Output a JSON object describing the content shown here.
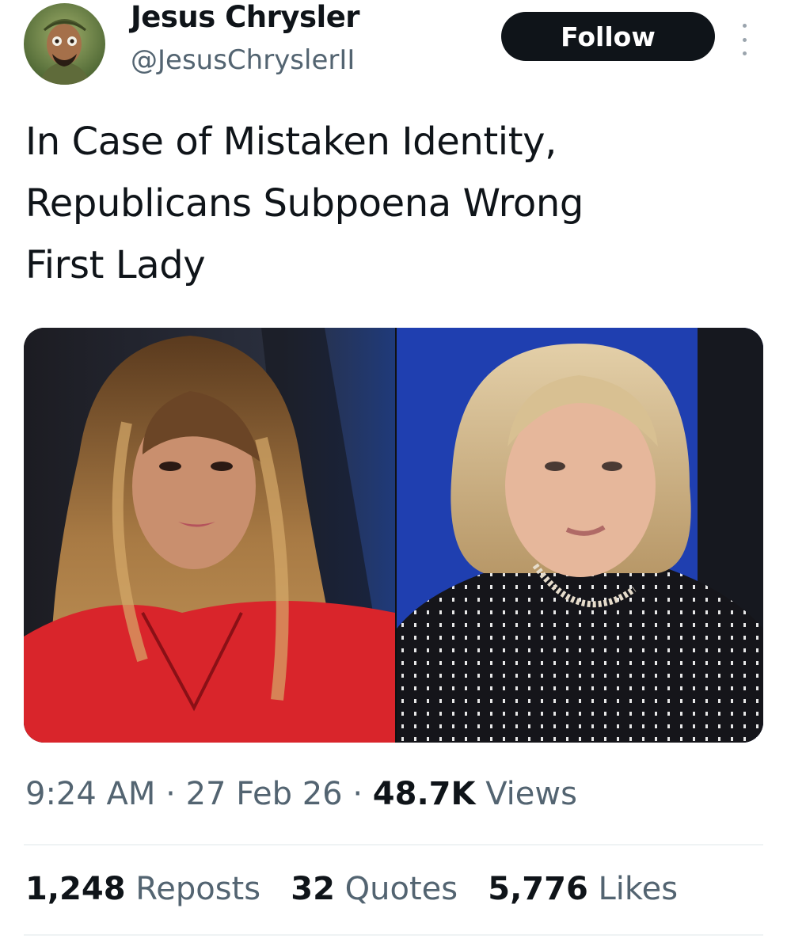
{
  "author": {
    "display_name": "Jesus Chrysler",
    "handle": "@JesusChryslerII"
  },
  "follow_button": {
    "label": "Follow"
  },
  "more_menu": {
    "icon": "more-vertical-icon"
  },
  "tweet": {
    "text": "In Case of Mistaken Identity,\nRepublicans Subpoena Wrong\nFirst Lady"
  },
  "meta": {
    "time": "9:24 AM",
    "separator": "·",
    "date": "27 Feb 26",
    "views_count": "48.7K",
    "views_label": "Views"
  },
  "stats": {
    "reposts_count": "1,248",
    "reposts_label": "Reposts",
    "quotes_count": "32",
    "quotes_label": "Quotes",
    "likes_count": "5,776",
    "likes_label": "Likes"
  },
  "colors": {
    "text_primary": "#0f1419",
    "text_secondary": "#536471",
    "follow_bg": "#0f1419",
    "divider": "#eff3f4"
  }
}
